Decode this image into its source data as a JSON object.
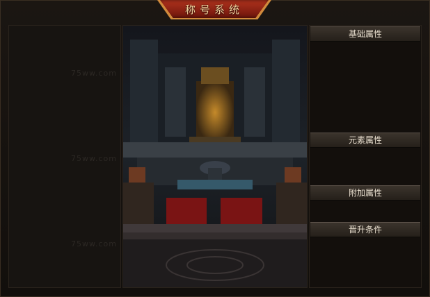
{
  "window": {
    "title": "称号系统"
  },
  "right_panel": {
    "sections": [
      {
        "label": "基础属性"
      },
      {
        "label": "元素属性"
      },
      {
        "label": "附加属性"
      },
      {
        "label": "晋升条件"
      }
    ]
  },
  "watermark": {
    "text": "75ww.com"
  },
  "colors": {
    "title_red": "#9e2a16",
    "title_text": "#f3d6a0",
    "carpet": "#7a1414"
  }
}
